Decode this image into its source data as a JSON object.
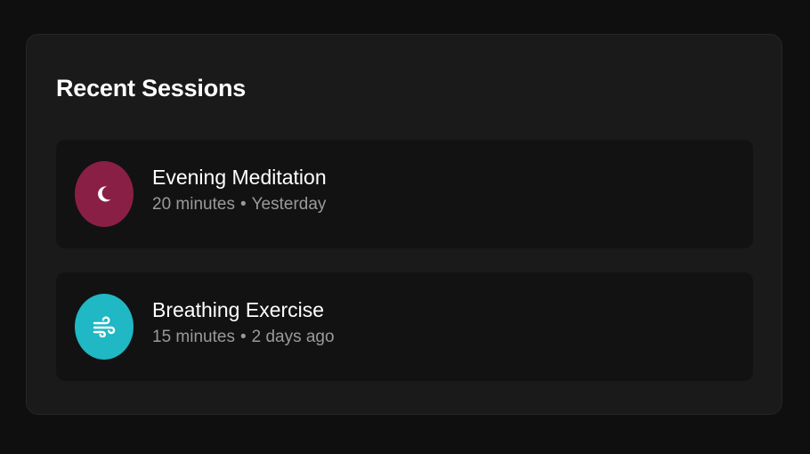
{
  "recent_sessions": {
    "title": "Recent Sessions",
    "items": [
      {
        "title": "Evening Meditation",
        "duration": "20 minutes",
        "when": "Yesterday",
        "icon": "moon-icon",
        "icon_bg": "#8a1f45"
      },
      {
        "title": "Breathing Exercise",
        "duration": "15 minutes",
        "when": "2 days ago",
        "icon": "wind-icon",
        "icon_bg": "#1fb8c4"
      }
    ],
    "separator": "•"
  }
}
